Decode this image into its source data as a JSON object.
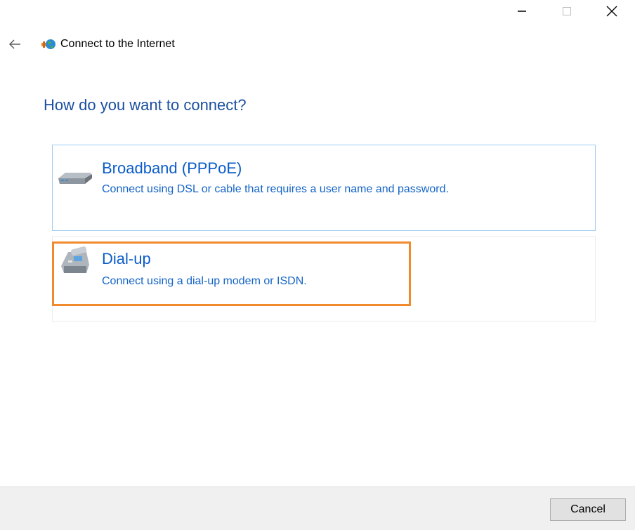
{
  "window": {
    "title": "Connect to the Internet",
    "controls": [
      "minimize-icon",
      "maximize-icon",
      "close-icon"
    ]
  },
  "heading": "How do you want to connect?",
  "options": [
    {
      "title": "Broadband (PPPoE)",
      "description": "Connect using DSL or cable that requires a user name and password.",
      "icon": "modem-icon"
    },
    {
      "title": "Dial-up",
      "description": "Connect using a dial-up modem or ISDN.",
      "icon": "telephone-icon",
      "highlighted": true
    }
  ],
  "footer": {
    "cancel_label": "Cancel"
  },
  "colors": {
    "heading": "#1a4fa0",
    "link": "#0b5cc9",
    "highlight": "#f08a2d",
    "selected_border": "#9ecbf0"
  }
}
